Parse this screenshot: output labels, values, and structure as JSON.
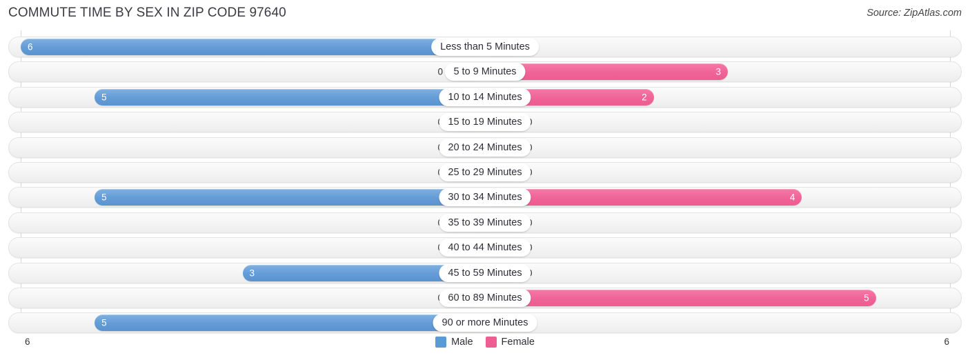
{
  "header": {
    "title": "COMMUTE TIME BY SEX IN ZIP CODE 97640",
    "source": "Source: ZipAtlas.com"
  },
  "legend": {
    "items": [
      {
        "label": "Male",
        "color": "#5b9bd5"
      },
      {
        "label": "Female",
        "color": "#ee5e92"
      }
    ]
  },
  "axis": {
    "left_tick": "6",
    "right_tick": "6"
  },
  "colors": {
    "male": "#5b9bd5",
    "male_zero": "#a8c9eb",
    "female": "#ee5e92",
    "female_zero": "#f9a6c3",
    "track": "#f2f2f2"
  },
  "chart_data": {
    "type": "bar",
    "title": "COMMUTE TIME BY SEX IN ZIP CODE 97640",
    "subtitle": "Source: ZipAtlas.com",
    "orientation": "horizontal-diverging",
    "xlabel": "",
    "ylabel": "",
    "xlim": [
      6,
      6
    ],
    "grid": false,
    "legend_position": "bottom-center",
    "categories": [
      "Less than 5 Minutes",
      "5 to 9 Minutes",
      "10 to 14 Minutes",
      "15 to 19 Minutes",
      "20 to 24 Minutes",
      "25 to 29 Minutes",
      "30 to 34 Minutes",
      "35 to 39 Minutes",
      "40 to 44 Minutes",
      "45 to 59 Minutes",
      "60 to 89 Minutes",
      "90 or more Minutes"
    ],
    "series": [
      {
        "name": "Male",
        "side": "left",
        "color": "#5b9bd5",
        "values": [
          6,
          0,
          5,
          0,
          0,
          0,
          5,
          0,
          0,
          3,
          0,
          5
        ],
        "labels": [
          "6",
          "0",
          "5",
          "0",
          "0",
          "0",
          "5",
          "0",
          "0",
          "3",
          "0",
          "5"
        ]
      },
      {
        "name": "Female",
        "side": "right",
        "color": "#ee5e92",
        "values": [
          0,
          3,
          2,
          0,
          0,
          0,
          4,
          0,
          0,
          0,
          5,
          0
        ],
        "labels": [
          "0",
          "3",
          "2",
          "0",
          "0",
          "0",
          "4",
          "0",
          "0",
          "0",
          "5",
          "0"
        ]
      }
    ],
    "max_value": 6
  }
}
